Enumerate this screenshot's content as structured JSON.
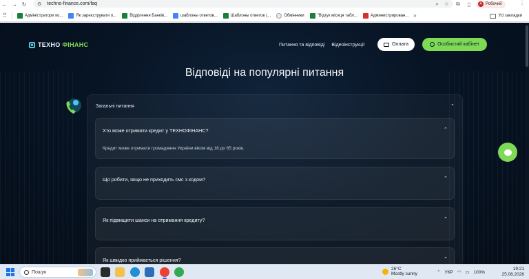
{
  "browser": {
    "url": "techno-finance.com/faq",
    "profile_name": "Робочий",
    "profile_initial": "А"
  },
  "bookmarks": {
    "items": [
      {
        "label": "Адміністратори ко...",
        "icon": "green"
      },
      {
        "label": "Як зареєструвати о...",
        "icon": "blue"
      },
      {
        "label": "Відділення Банків...",
        "icon": "green"
      },
      {
        "label": "шаблоны ответов...",
        "icon": "blue"
      },
      {
        "label": "Шаблоны ответов (...",
        "icon": "green"
      },
      {
        "label": "Обмінники",
        "icon": "globe"
      },
      {
        "label": "\"Відгук місяця табл...",
        "icon": "green"
      },
      {
        "label": "Администрирован...",
        "icon": "red"
      }
    ],
    "all_bookmarks_label": "Усі закладки"
  },
  "site": {
    "logo_part1": "ТЕХНО",
    "logo_part2": "ФІНАНС",
    "nav": {
      "faq_link": "Питання та відповіді",
      "video_link": "Відеоінструкції",
      "pay_button": "Оплата",
      "cabinet_button": "Особистий кабінет"
    },
    "page_title": "Відповіді на популярні питання",
    "faq_section_title": "Загальні питання",
    "faq": [
      {
        "question": "Хто може отримати кредит у ТЕХНОФІНАНС?",
        "answer": "Кредит може отримати громадянин України віком від 18 до 65 років."
      },
      {
        "question": "Що робити, якщо не приходить смс з кодом?",
        "answer": ""
      },
      {
        "question": "Як підвищити шанси на отримання кредиту?",
        "answer": ""
      },
      {
        "question": "Як швидко приймається рішення?",
        "answer": ""
      }
    ],
    "colors": {
      "accent_green": "#7ed957",
      "background": "#071424"
    }
  },
  "taskbar": {
    "search_placeholder": "Пошук",
    "weather_temp": "26°C",
    "weather_desc": "Mostly sunny",
    "language": "УКР",
    "battery": "100%",
    "time": "19:21",
    "date": "25.08.2026"
  }
}
